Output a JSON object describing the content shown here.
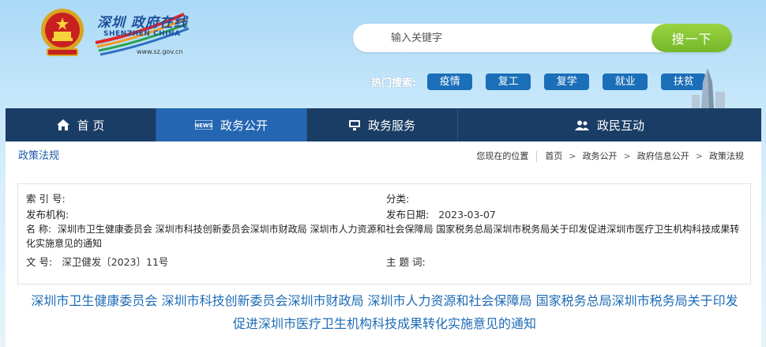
{
  "header": {
    "logo_cn": "深圳 政府在线",
    "logo_en": "SHENZHEN CHINA",
    "logo_url": "www.sz.gov.cn"
  },
  "search": {
    "placeholder": "输入关键字",
    "button_label": "搜一下"
  },
  "hot_search": {
    "label": "热门搜索:",
    "tags": [
      "疫情",
      "复工",
      "复学",
      "就业",
      "扶贫"
    ]
  },
  "nav": {
    "items": [
      {
        "label": "首 页",
        "icon": "home-icon"
      },
      {
        "label": "政务公开",
        "icon": "news-icon"
      },
      {
        "label": "政务服务",
        "icon": "monitor-icon"
      },
      {
        "label": "政民互动",
        "icon": "people-icon"
      }
    ],
    "active_index": 1
  },
  "section": {
    "title": "政策法规"
  },
  "breadcrumb": {
    "prefix": "您现在的位置",
    "items": [
      "首页",
      "政务公开",
      "政府信息公开",
      "政策法规"
    ]
  },
  "meta": {
    "index_label": "索 引 号:",
    "index_value": "",
    "category_label": "分类:",
    "category_value": "",
    "publisher_label": "发布机构:",
    "publisher_value": "",
    "date_label": "发布日期:",
    "date_value": "2023-03-07",
    "name_label": "名  称:",
    "name_value": "深圳市卫生健康委员会 深圳市科技创新委员会深圳市财政局 深圳市人力资源和社会保障局 国家税务总局深圳市税务局关于印发促进深圳市医疗卫生机构科技成果转化实施意见的通知",
    "docno_label": "文  号:",
    "docno_value": "深卫健发〔2023〕11号",
    "subject_label": "主 题 词:",
    "subject_value": ""
  },
  "document": {
    "title": "深圳市卫生健康委员会 深圳市科技创新委员会深圳市财政局 深圳市人力资源和社会保障局 国家税务总局深圳市税务局关于印发促进深圳市医疗卫生机构科技成果转化实施意见的通知"
  },
  "colors": {
    "nav_bg": "#1a3d66",
    "nav_active": "#2466b2",
    "search_button": "#82c232",
    "hot_tag": "#1a6fb8",
    "title_blue": "#1d6bb5"
  }
}
